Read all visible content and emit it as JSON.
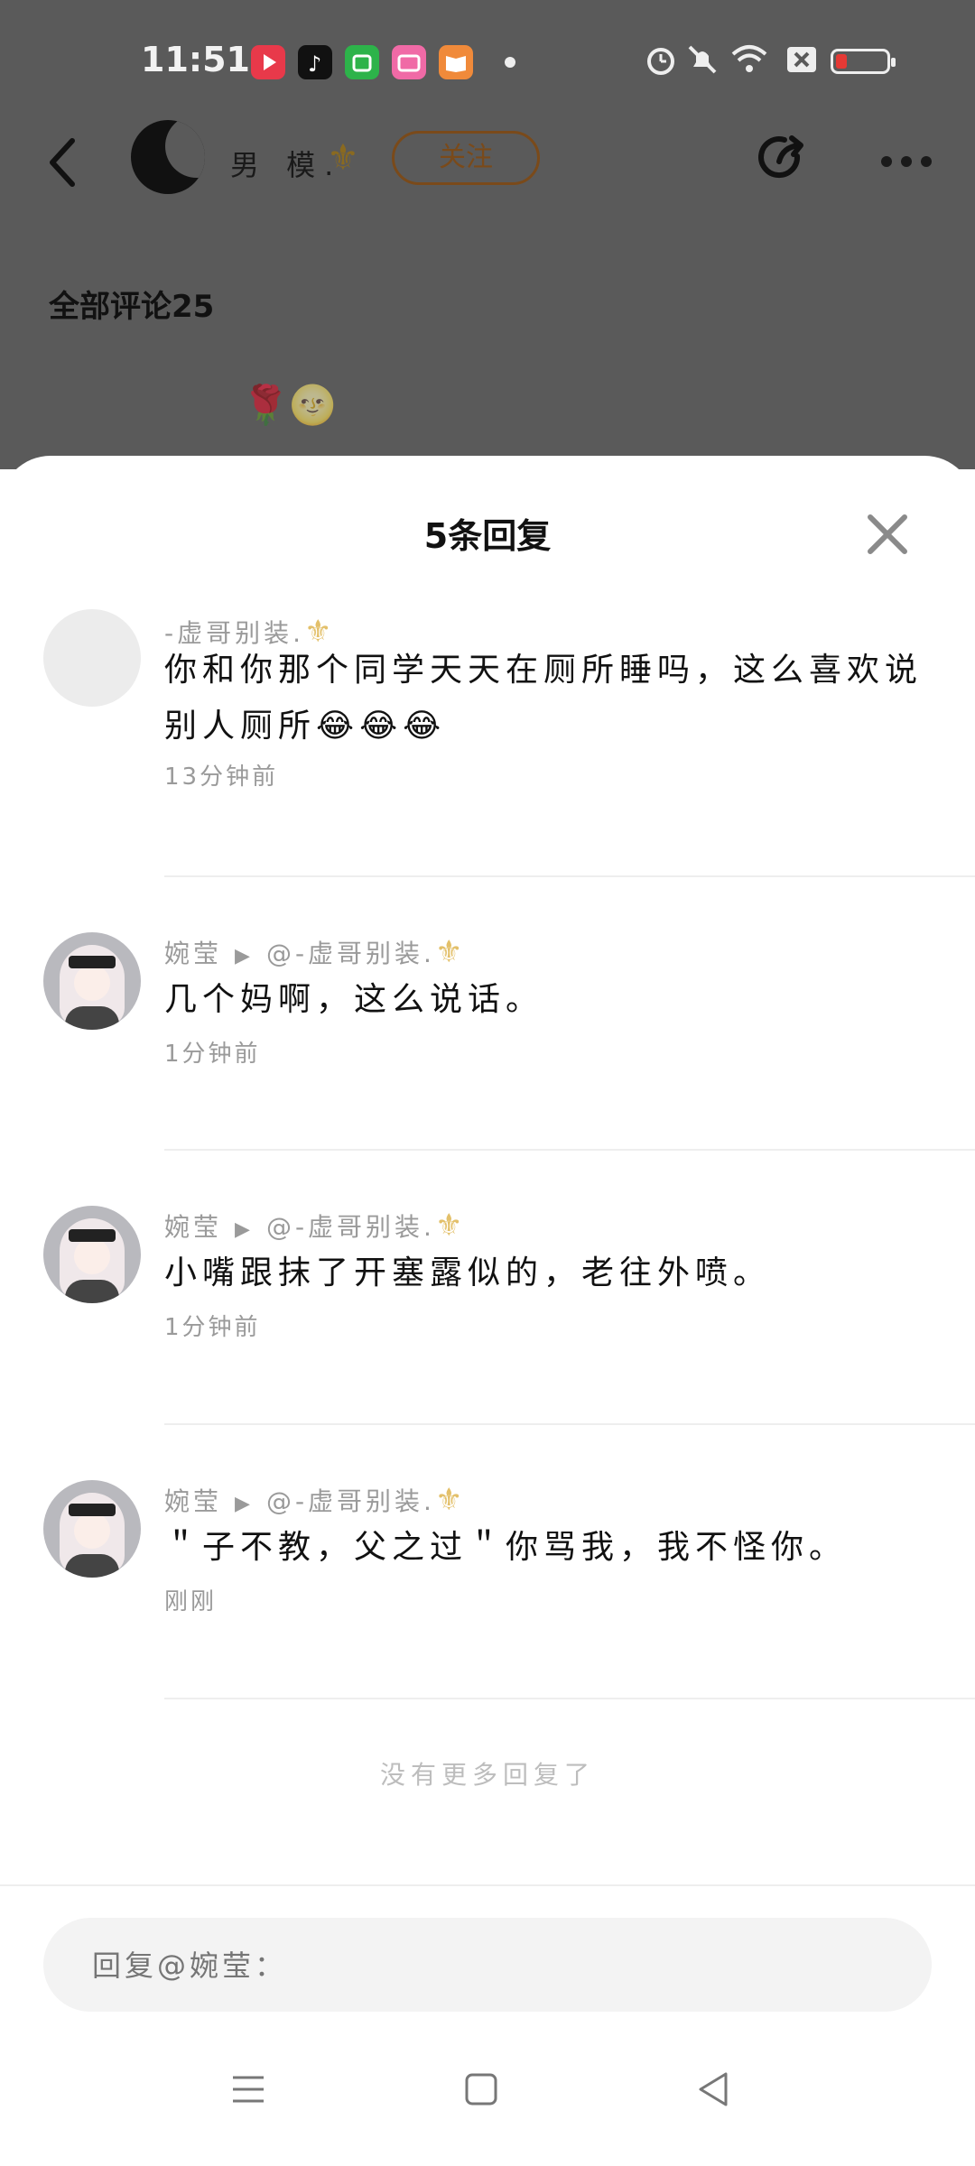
{
  "status_bar": {
    "time": "11:51",
    "apps": [
      "youtube-app-icon",
      "tiktok-app-icon",
      "green-app-icon",
      "bilibili-app-icon",
      "books-app-icon"
    ]
  },
  "header": {
    "username": "男 模.",
    "follow_label": "关注"
  },
  "comments_section": {
    "title": "全部评论25",
    "emojis": "🌹🌝"
  },
  "sheet": {
    "title": "5条回复",
    "replies": [
      {
        "author": "-虚哥别装.",
        "text": "你和你那个同学天天在厕所睡吗，这么喜欢说别人厕所😂😂😂",
        "time": "13分钟前"
      },
      {
        "author": "婉莹",
        "reply_to": "@-虚哥别装.",
        "text": "几个妈啊，这么说话。",
        "time": "1分钟前"
      },
      {
        "author": "婉莹",
        "reply_to": "@-虚哥别装.",
        "text": "小嘴跟抹了开塞露似的，老往外喷。",
        "time": "1分钟前"
      },
      {
        "author": "婉莹",
        "reply_to": "@-虚哥别装.",
        "text": "＂子不教，父之过＂你骂我，我不怪你。",
        "time": "刚刚"
      }
    ],
    "no_more": "没有更多回复了",
    "input_placeholder": "回复@婉莹："
  },
  "colors": {
    "overlay": "#5a5a5a",
    "follow_border": "#7a4a1a",
    "muted_text": "#9a9a9a",
    "fleur_gold": "#e3c06a"
  }
}
